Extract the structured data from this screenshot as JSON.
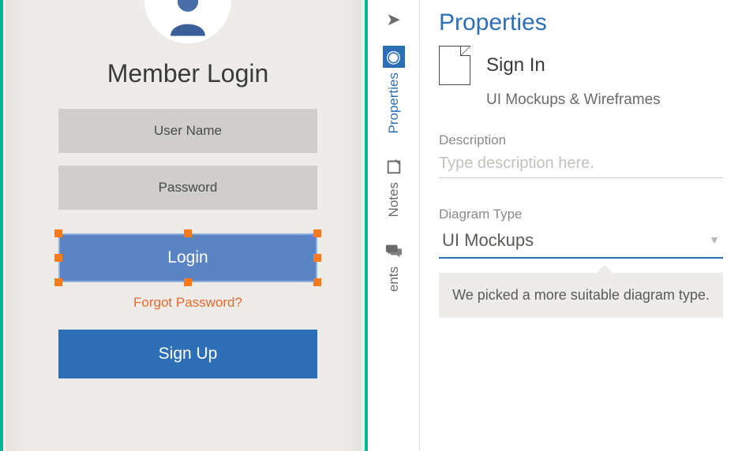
{
  "canvas": {
    "title": "Member Login",
    "username_placeholder": "User Name",
    "password_placeholder": "Password",
    "login_button": "Login",
    "forgot_link": "Forgot Password?",
    "signup_button": "Sign Up"
  },
  "tabs": {
    "properties": "Properties",
    "notes": "Notes",
    "comments": "ents"
  },
  "panel": {
    "title": "Properties",
    "doc_name": "Sign In",
    "doc_subtitle": "UI Mockups & Wireframes",
    "description_label": "Description",
    "description_placeholder": "Type description here.",
    "diagram_type_label": "Diagram Type",
    "diagram_type_value": "UI Mockups",
    "tooltip": "We picked a more suitable diagram type."
  }
}
